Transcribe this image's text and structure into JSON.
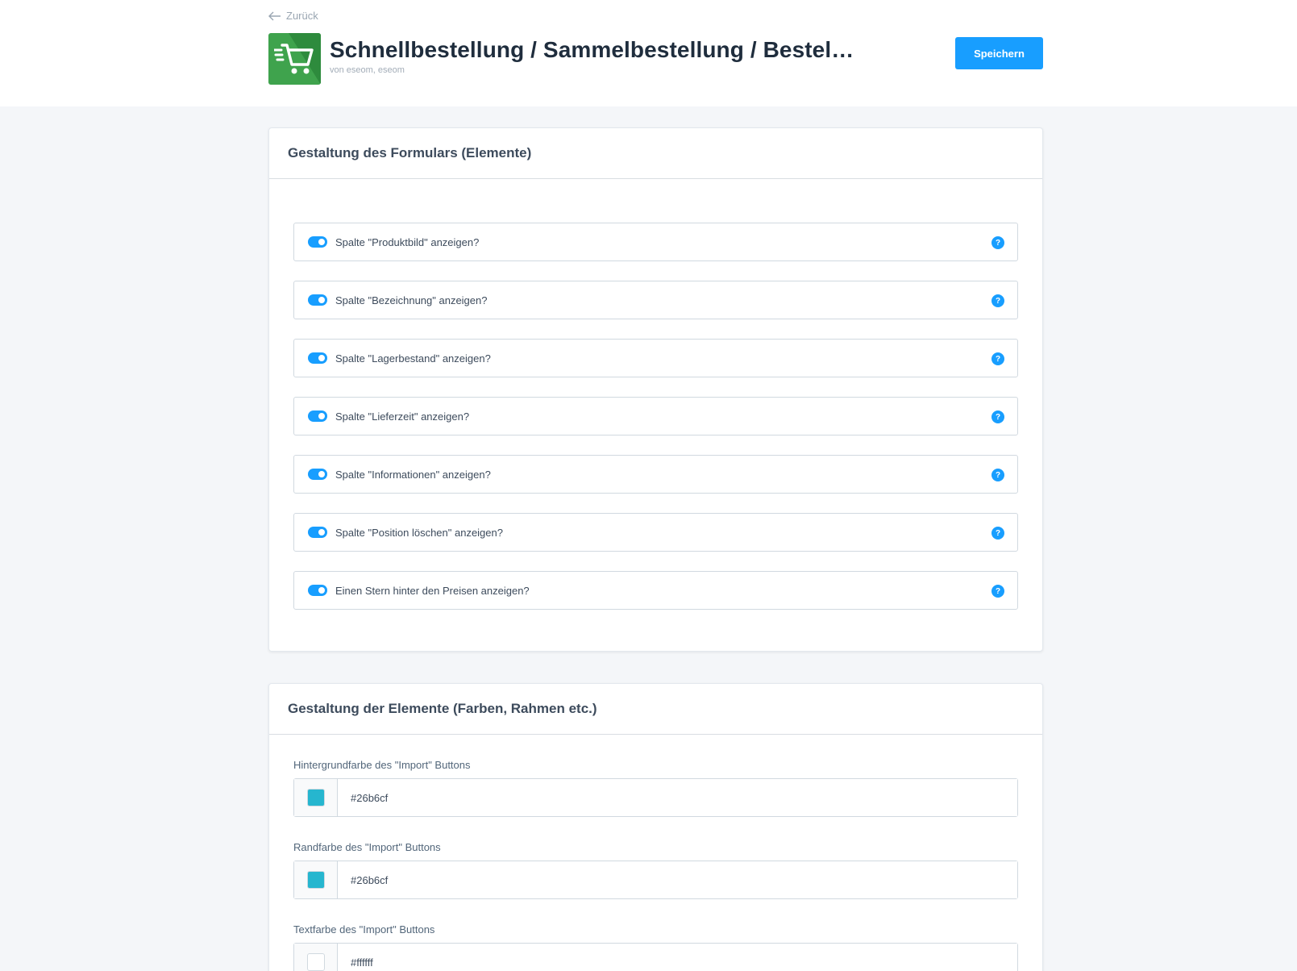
{
  "header": {
    "back_label": "Zurück",
    "title": "Schnellbestellung / Sammelbestellung / Bestel…",
    "vendor": "von eseom, eseom",
    "save_label": "Speichern",
    "icon": "shopping-cart-icon",
    "icon_color": "#3fa34d"
  },
  "section1": {
    "title": "Gestaltung des Formulars (Elemente)",
    "toggles": [
      {
        "label": "Spalte \"Produktbild\" anzeigen?",
        "on": true
      },
      {
        "label": "Spalte \"Bezeichnung\" anzeigen?",
        "on": true
      },
      {
        "label": "Spalte \"Lagerbestand\" anzeigen?",
        "on": true
      },
      {
        "label": "Spalte \"Lieferzeit\" anzeigen?",
        "on": true
      },
      {
        "label": "Spalte \"Informationen\" anzeigen?",
        "on": true
      },
      {
        "label": "Spalte \"Position löschen\" anzeigen?",
        "on": true
      },
      {
        "label": "Einen Stern hinter den Preisen anzeigen?",
        "on": true
      }
    ],
    "help_glyph": "?"
  },
  "section2": {
    "title": "Gestaltung der Elemente (Farben, Rahmen etc.)",
    "fields": [
      {
        "label": "Hintergrundfarbe des \"Import\" Buttons",
        "value": "#26b6cf",
        "swatch": "#26b6cf"
      },
      {
        "label": "Randfarbe des \"Import\" Buttons",
        "value": "#26b6cf",
        "swatch": "#26b6cf"
      },
      {
        "label": "Textfarbe des \"Import\" Buttons",
        "value": "#ffffff",
        "swatch": "#ffffff"
      }
    ]
  },
  "colors": {
    "accent": "#189eff",
    "background": "#f4f6f9"
  }
}
